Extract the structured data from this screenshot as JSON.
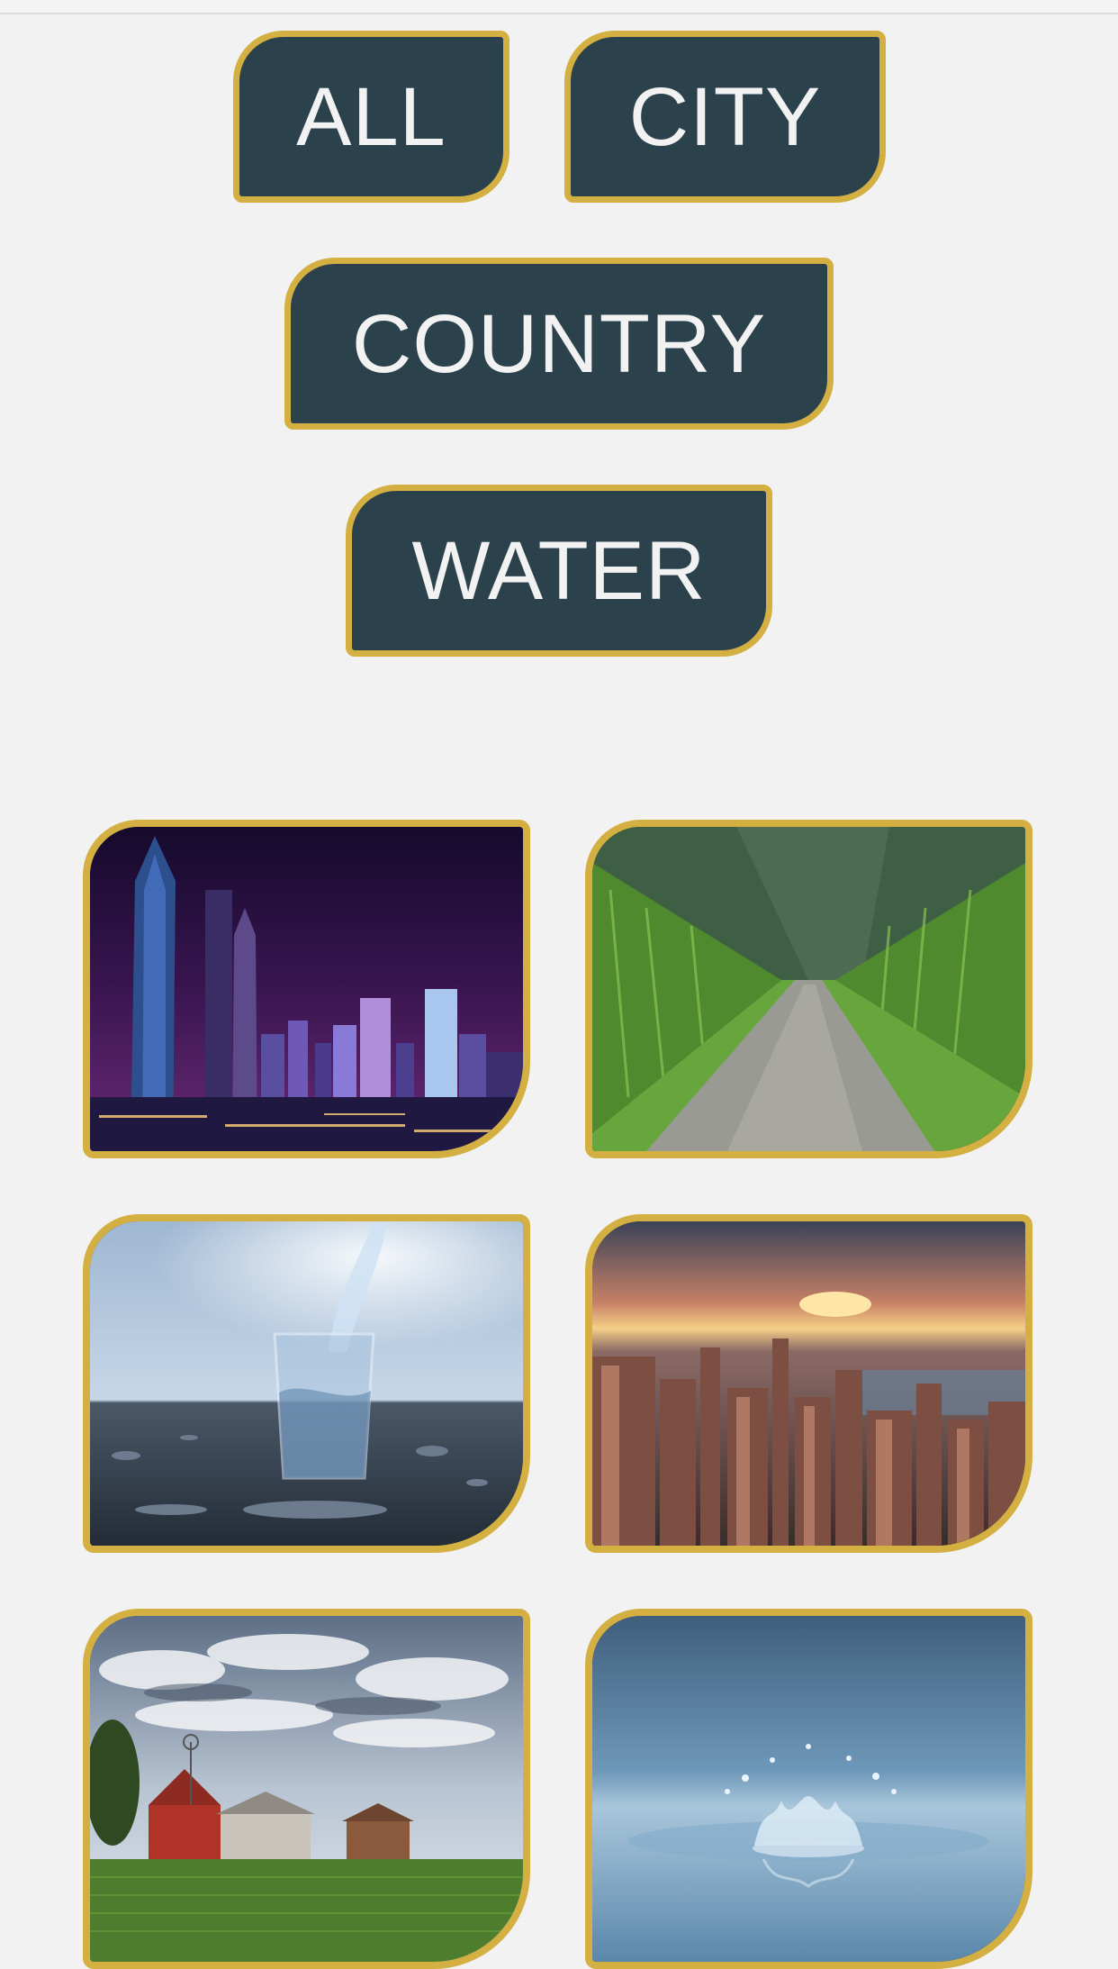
{
  "filters": {
    "all": "ALL",
    "city": "CITY",
    "country": "COUNTRY",
    "water": "WATER"
  },
  "colors": {
    "background": "#f2f2f2",
    "button_fill": "#2b424d",
    "accent_border": "#d4b043",
    "button_text": "#f2f2f2"
  },
  "gallery": [
    {
      "category": "city",
      "subject": "night-skyline"
    },
    {
      "category": "country",
      "subject": "cornfield-road"
    },
    {
      "category": "water",
      "subject": "glass-of-water"
    },
    {
      "category": "city",
      "subject": "aerial-city-sunset"
    },
    {
      "category": "country",
      "subject": "red-barn-farm"
    },
    {
      "category": "water",
      "subject": "water-drop-splash"
    }
  ]
}
